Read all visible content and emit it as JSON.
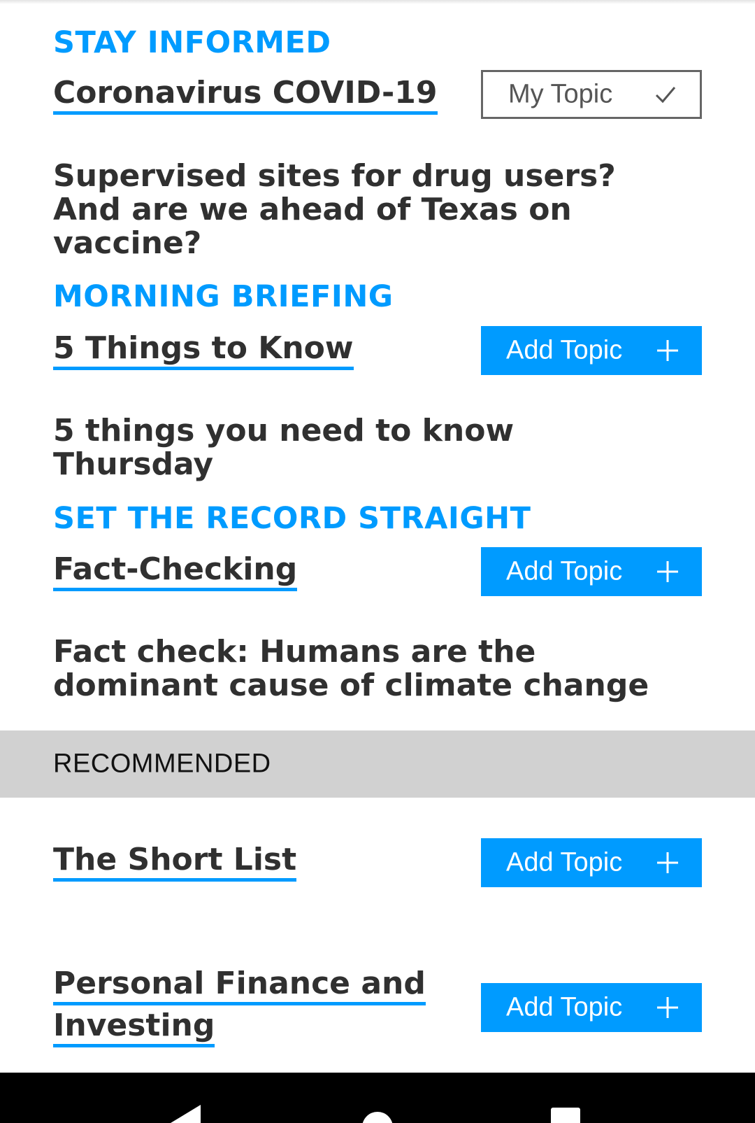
{
  "sections": [
    {
      "kicker": "STAY INFORMED",
      "title": "Coronavirus COVID-19",
      "button_label": "My Topic",
      "headline": "Supervised sites for drug users? And are we ahead of Texas on vaccine?"
    },
    {
      "kicker": "MORNING BRIEFING",
      "title": "5 Things to Know",
      "button_label": "Add Topic",
      "headline": "5 things you need to know Thursday"
    },
    {
      "kicker": "SET THE RECORD STRAIGHT",
      "title": "Fact-Checking",
      "button_label": "Add Topic",
      "headline": "Fact check: Humans are the dominant cause of climate change"
    }
  ],
  "recommended": {
    "header": "RECOMMENDED",
    "items": [
      {
        "title": "The Short List",
        "button_label": "Add Topic"
      },
      {
        "title_line1": "Personal Finance and",
        "title_line2": "Investing",
        "button_label": "Add Topic"
      }
    ]
  },
  "colors": {
    "accent": "#009bff",
    "text": "#303030",
    "recommended_bar": "#d1d1d1",
    "nav_bar": "#000000"
  },
  "icons": {
    "followed": "check-icon",
    "add": "plus-icon",
    "nav": [
      "back-icon",
      "home-icon",
      "recents-icon"
    ]
  }
}
